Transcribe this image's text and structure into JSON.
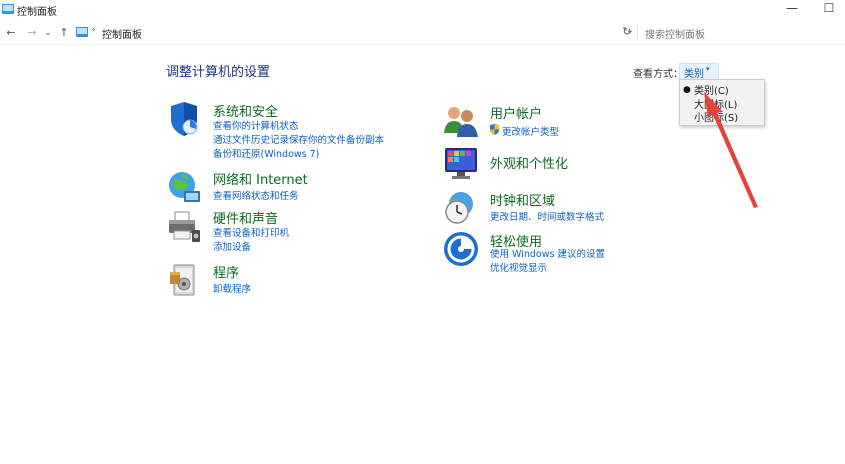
{
  "window": {
    "title": "控制面板",
    "controls": {
      "minimize": "—",
      "maximize": "☐"
    }
  },
  "nav": {
    "back": "←",
    "forward": "→",
    "recent": "⌄",
    "up": "↑",
    "breadcrumb_sep": "›",
    "breadcrumb": "控制面板",
    "dropdown": "⌄",
    "refresh": "↻"
  },
  "search": {
    "placeholder": "搜索控制面板"
  },
  "page": {
    "title": "调整计算机的设置",
    "viewby_label": "查看方式：",
    "viewby_value": "类别",
    "viewby_arrow": "▾"
  },
  "menu": {
    "bullet": "●",
    "items": [
      "类别(C)",
      "大图标(L)",
      "小图标(S)"
    ]
  },
  "categories": {
    "system": {
      "title": "系统和安全",
      "links": [
        "查看你的计算机状态",
        "通过文件历史记录保存你的文件备份副本",
        "备份和还原(Windows 7)"
      ]
    },
    "network": {
      "title": "网络和 Internet",
      "links": [
        "查看网络状态和任务"
      ]
    },
    "hardware": {
      "title": "硬件和声音",
      "links": [
        "查看设备和打印机",
        "添加设备"
      ]
    },
    "programs": {
      "title": "程序",
      "links": [
        "卸载程序"
      ]
    },
    "users": {
      "title": "用户帐户",
      "links": [
        "更改帐户类型"
      ]
    },
    "appearance": {
      "title": "外观和个性化"
    },
    "clock": {
      "title": "时钟和区域",
      "links": [
        "更改日期、时间或数字格式"
      ]
    },
    "ease": {
      "title": "轻松使用",
      "links": [
        "使用 Windows 建议的设置",
        "优化视觉显示"
      ]
    }
  },
  "colors": {
    "link": "#0b62c4",
    "category_title": "#0b6a20",
    "page_title": "#1e3287",
    "annotation_arrow": "#e8413a"
  }
}
